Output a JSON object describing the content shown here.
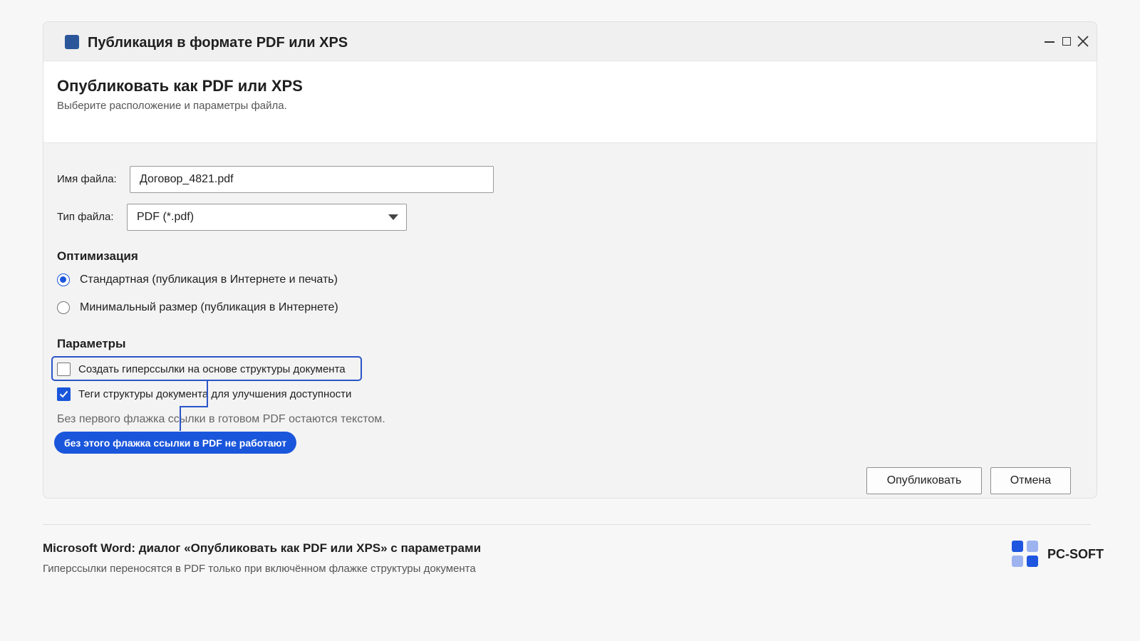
{
  "window": {
    "title": "Публикация в формате PDF или XPS",
    "icon": "word-app-icon",
    "controls": [
      "minimize-icon",
      "maximize-icon",
      "close-icon"
    ]
  },
  "header": {
    "title": "Опубликовать как PDF или XPS",
    "subtitle": "Выберите расположение и параметры файла."
  },
  "form": {
    "filename_label": "Имя файла:",
    "filename_value": "Договор_4821.pdf",
    "filetype_label": "Тип файла:",
    "filetype_value": "PDF (*.pdf)"
  },
  "optimization": {
    "title": "Оптимизация",
    "options": [
      {
        "label": "Стандартная (публикация в Интернете и печать)",
        "selected": true
      },
      {
        "label": "Минимальный размер (публикация в Интернете)",
        "selected": false
      }
    ]
  },
  "params": {
    "title": "Параметры",
    "checkboxes": [
      {
        "label": "Создать гиперссылки на основе структуры документа",
        "checked": false
      },
      {
        "label": "Теги структуры документа для улучшения доступности",
        "checked": true
      }
    ],
    "hint": "Без первого флажка ссылки в готовом PDF остаются текстом.",
    "callout": "без этого флажка ссылки в PDF не работают"
  },
  "buttons": {
    "publish": "Опубликовать",
    "cancel": "Отмена"
  },
  "footer": {
    "caption_title": "Microsoft Word: диалог «Опубликовать как PDF или XPS» с параметрами",
    "caption_sub": "Гиперссылки переносятся в PDF только при включённом флажке структуры документа",
    "brand": "PC-SOFT"
  },
  "colors": {
    "accent": "#1a56db",
    "app_icon": "#2b579a",
    "highlight": "#2a55c9",
    "brand_dark": "#1f56e0",
    "brand_light": "#9db3f0"
  }
}
